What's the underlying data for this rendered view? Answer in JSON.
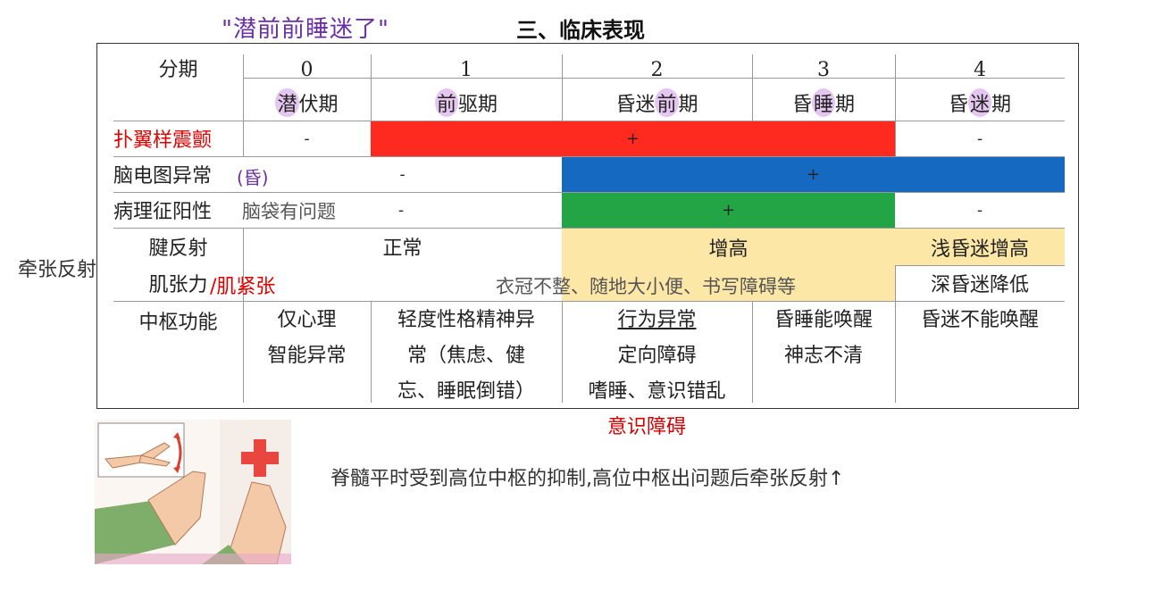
{
  "title": "三、临床表现",
  "notes": {
    "top": "\"潜前前睡迷了\"",
    "left": "牵张反射↑",
    "bottom": "意识障碍",
    "spinal": "脊髓平时受到高位中枢的抑制,高位中枢出问题后牵张反射↑",
    "behavior": "衣冠不整、随地大小便、书写障碍等",
    "muscle_tone": "/肌紧张",
    "eeg_paren": "(昏)",
    "pathology": "脑袋有问题"
  },
  "header": {
    "stage_label": "分期",
    "stages": [
      "0",
      "1",
      "2",
      "3",
      "4"
    ],
    "stage_names": [
      {
        "hl": "潜",
        "rest": "伏期"
      },
      {
        "hl": "前",
        "rest": "驱期"
      },
      {
        "pre": "昏迷",
        "hl": "前",
        "rest": "期"
      },
      {
        "pre": "昏",
        "hl": "睡",
        "rest": "期"
      },
      {
        "pre": "昏",
        "hl": "迷",
        "rest": "期"
      }
    ]
  },
  "rows": {
    "asterixis": {
      "label": "扑翼样震颤",
      "minus0": "-",
      "plus": "+",
      "minus4": "-",
      "color": "#ff2a1f"
    },
    "eeg": {
      "label": "脑电图异常",
      "minus": "-",
      "plus": "+",
      "color": "#1669c0"
    },
    "pathological": {
      "label": "病理征阳性",
      "minus": "-",
      "plus": "+",
      "minus4": "-",
      "color": "#23a546"
    },
    "tendon": {
      "label": "腱反射",
      "normal": "正常",
      "high": "增高",
      "light": "浅昏迷增高",
      "deep": "深昏迷降低",
      "color": "#fde7a6",
      "color_light": "#fde7a6"
    },
    "muscle": {
      "label": "肌张力"
    },
    "cns": {
      "label": "中枢功能",
      "c0": [
        "仅心理",
        "智能异常"
      ],
      "c1": [
        "轻度性格精神异",
        "常（焦虑、健",
        "忘、睡眠倒错）"
      ],
      "c2": [
        "行为异常",
        "定向障碍",
        "嗜睡、意识错乱"
      ],
      "c3": [
        "昏睡能唤醒",
        "神志不清"
      ],
      "c4": [
        "昏迷不能唤醒"
      ]
    }
  }
}
